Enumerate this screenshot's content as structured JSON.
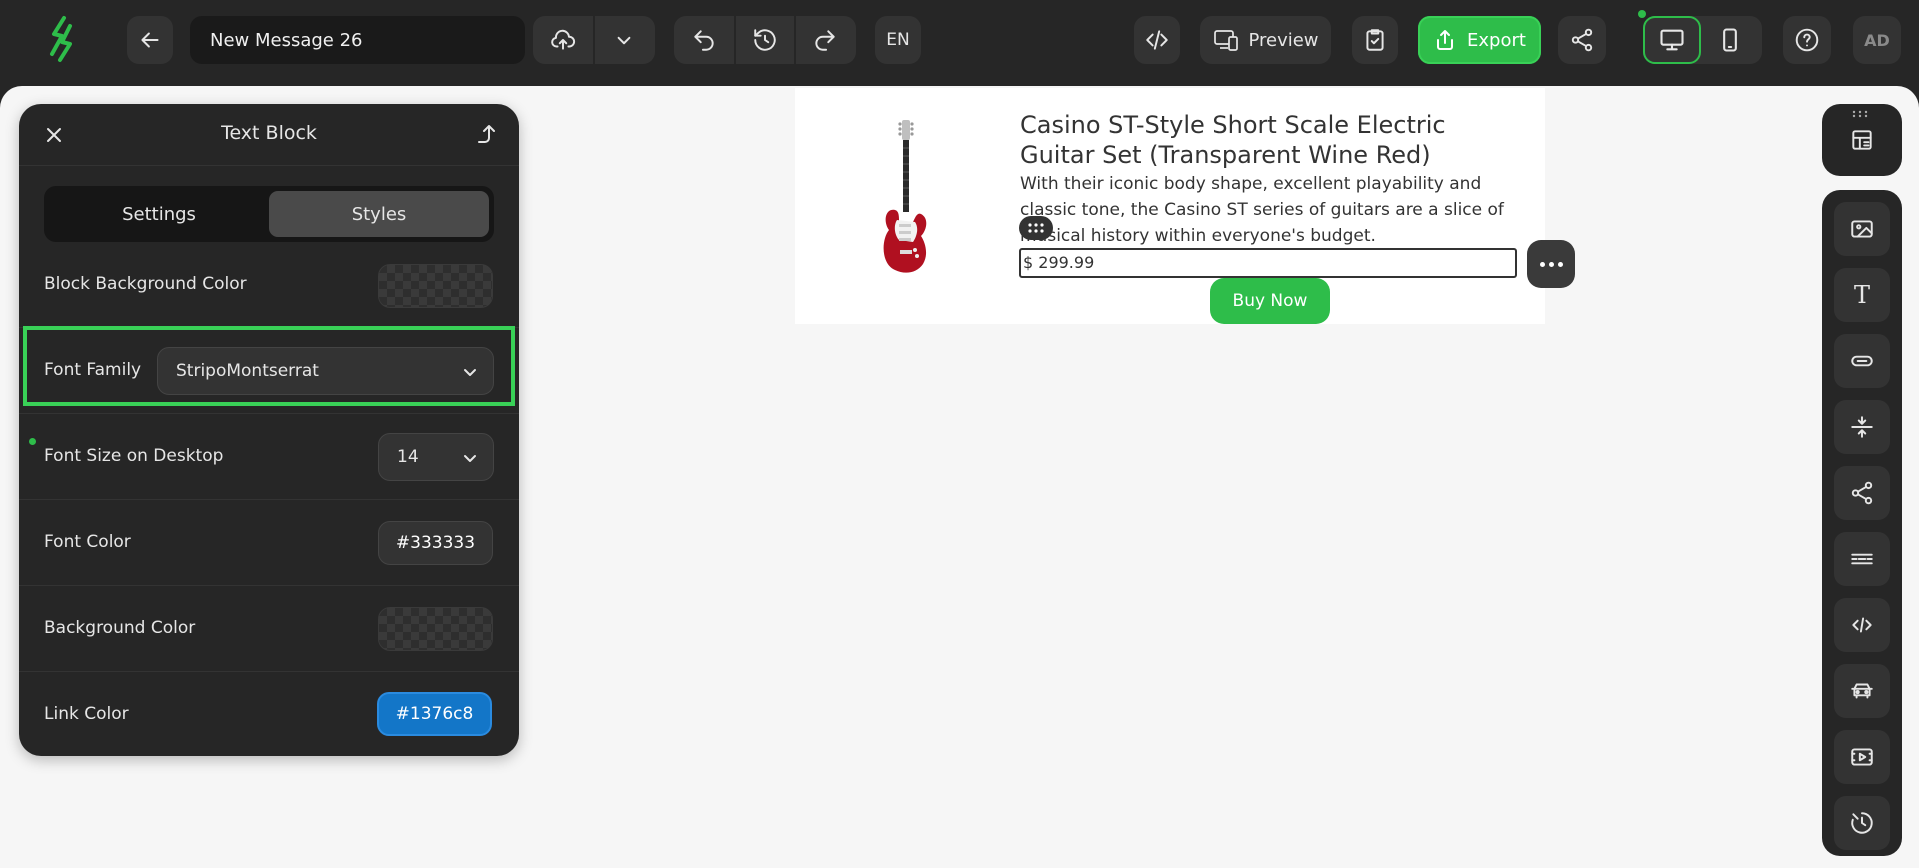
{
  "app": {
    "message_title": "New Message 26",
    "language": "EN",
    "preview_label": "Preview",
    "export_label": "Export",
    "avatar_initials": "AD",
    "brand_color": "#2ebd4a"
  },
  "panel": {
    "title": "Text Block",
    "tabs": [
      {
        "label": "Settings",
        "active": false
      },
      {
        "label": "Styles",
        "active": true
      }
    ],
    "rows": {
      "block_bg_label": "Block Background Color",
      "font_family_label": "Font Family",
      "font_family_value": "StripoMontserrat",
      "font_size_label": "Font Size on Desktop",
      "font_size_value": "14",
      "font_color_label": "Font Color",
      "font_color_value": "#333333",
      "bg_color_label": "Background Color",
      "link_color_label": "Link Color",
      "link_color_value": "#1376c8"
    }
  },
  "email": {
    "product_title": "Casino ST-Style Short Scale Electric Guitar Set (Transparent Wine Red)",
    "description": "With their iconic body shape, excellent playability and classic tone, the Casino ST series of guitars are a slice of musical history within everyone's budget.",
    "price": "$ 299.99",
    "button_label": "Buy Now"
  },
  "right_toolbar": {
    "items": [
      "structure-icon",
      "image-icon",
      "text-icon",
      "button-icon",
      "spacer-icon",
      "social-icon",
      "menu-icon",
      "html-icon",
      "carousel-icon",
      "video-icon",
      "timer-icon"
    ]
  }
}
